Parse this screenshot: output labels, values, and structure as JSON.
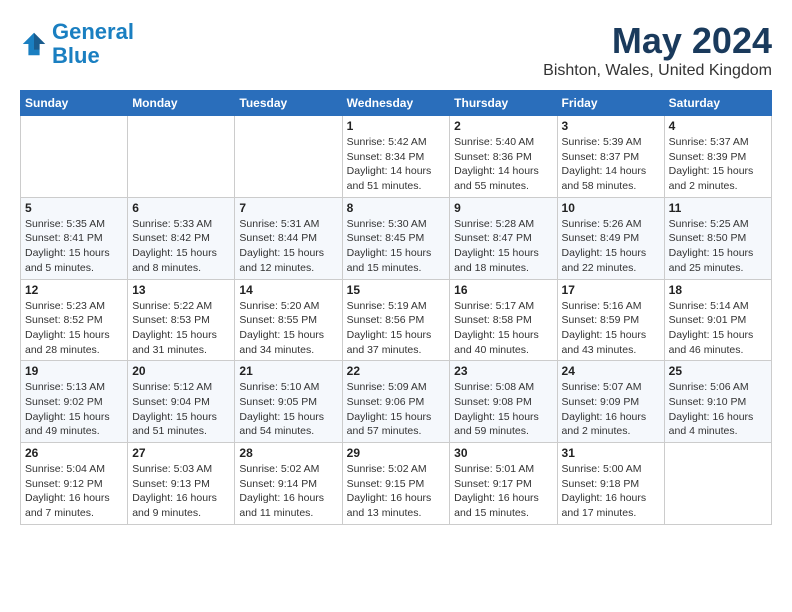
{
  "logo": {
    "line1": "General",
    "line2": "Blue"
  },
  "title": "May 2024",
  "subtitle": "Bishton, Wales, United Kingdom",
  "days_of_week": [
    "Sunday",
    "Monday",
    "Tuesday",
    "Wednesday",
    "Thursday",
    "Friday",
    "Saturday"
  ],
  "weeks": [
    [
      {
        "day": "",
        "info": ""
      },
      {
        "day": "",
        "info": ""
      },
      {
        "day": "",
        "info": ""
      },
      {
        "day": "1",
        "info": "Sunrise: 5:42 AM\nSunset: 8:34 PM\nDaylight: 14 hours\nand 51 minutes."
      },
      {
        "day": "2",
        "info": "Sunrise: 5:40 AM\nSunset: 8:36 PM\nDaylight: 14 hours\nand 55 minutes."
      },
      {
        "day": "3",
        "info": "Sunrise: 5:39 AM\nSunset: 8:37 PM\nDaylight: 14 hours\nand 58 minutes."
      },
      {
        "day": "4",
        "info": "Sunrise: 5:37 AM\nSunset: 8:39 PM\nDaylight: 15 hours\nand 2 minutes."
      }
    ],
    [
      {
        "day": "5",
        "info": "Sunrise: 5:35 AM\nSunset: 8:41 PM\nDaylight: 15 hours\nand 5 minutes."
      },
      {
        "day": "6",
        "info": "Sunrise: 5:33 AM\nSunset: 8:42 PM\nDaylight: 15 hours\nand 8 minutes."
      },
      {
        "day": "7",
        "info": "Sunrise: 5:31 AM\nSunset: 8:44 PM\nDaylight: 15 hours\nand 12 minutes."
      },
      {
        "day": "8",
        "info": "Sunrise: 5:30 AM\nSunset: 8:45 PM\nDaylight: 15 hours\nand 15 minutes."
      },
      {
        "day": "9",
        "info": "Sunrise: 5:28 AM\nSunset: 8:47 PM\nDaylight: 15 hours\nand 18 minutes."
      },
      {
        "day": "10",
        "info": "Sunrise: 5:26 AM\nSunset: 8:49 PM\nDaylight: 15 hours\nand 22 minutes."
      },
      {
        "day": "11",
        "info": "Sunrise: 5:25 AM\nSunset: 8:50 PM\nDaylight: 15 hours\nand 25 minutes."
      }
    ],
    [
      {
        "day": "12",
        "info": "Sunrise: 5:23 AM\nSunset: 8:52 PM\nDaylight: 15 hours\nand 28 minutes."
      },
      {
        "day": "13",
        "info": "Sunrise: 5:22 AM\nSunset: 8:53 PM\nDaylight: 15 hours\nand 31 minutes."
      },
      {
        "day": "14",
        "info": "Sunrise: 5:20 AM\nSunset: 8:55 PM\nDaylight: 15 hours\nand 34 minutes."
      },
      {
        "day": "15",
        "info": "Sunrise: 5:19 AM\nSunset: 8:56 PM\nDaylight: 15 hours\nand 37 minutes."
      },
      {
        "day": "16",
        "info": "Sunrise: 5:17 AM\nSunset: 8:58 PM\nDaylight: 15 hours\nand 40 minutes."
      },
      {
        "day": "17",
        "info": "Sunrise: 5:16 AM\nSunset: 8:59 PM\nDaylight: 15 hours\nand 43 minutes."
      },
      {
        "day": "18",
        "info": "Sunrise: 5:14 AM\nSunset: 9:01 PM\nDaylight: 15 hours\nand 46 minutes."
      }
    ],
    [
      {
        "day": "19",
        "info": "Sunrise: 5:13 AM\nSunset: 9:02 PM\nDaylight: 15 hours\nand 49 minutes."
      },
      {
        "day": "20",
        "info": "Sunrise: 5:12 AM\nSunset: 9:04 PM\nDaylight: 15 hours\nand 51 minutes."
      },
      {
        "day": "21",
        "info": "Sunrise: 5:10 AM\nSunset: 9:05 PM\nDaylight: 15 hours\nand 54 minutes."
      },
      {
        "day": "22",
        "info": "Sunrise: 5:09 AM\nSunset: 9:06 PM\nDaylight: 15 hours\nand 57 minutes."
      },
      {
        "day": "23",
        "info": "Sunrise: 5:08 AM\nSunset: 9:08 PM\nDaylight: 15 hours\nand 59 minutes."
      },
      {
        "day": "24",
        "info": "Sunrise: 5:07 AM\nSunset: 9:09 PM\nDaylight: 16 hours\nand 2 minutes."
      },
      {
        "day": "25",
        "info": "Sunrise: 5:06 AM\nSunset: 9:10 PM\nDaylight: 16 hours\nand 4 minutes."
      }
    ],
    [
      {
        "day": "26",
        "info": "Sunrise: 5:04 AM\nSunset: 9:12 PM\nDaylight: 16 hours\nand 7 minutes."
      },
      {
        "day": "27",
        "info": "Sunrise: 5:03 AM\nSunset: 9:13 PM\nDaylight: 16 hours\nand 9 minutes."
      },
      {
        "day": "28",
        "info": "Sunrise: 5:02 AM\nSunset: 9:14 PM\nDaylight: 16 hours\nand 11 minutes."
      },
      {
        "day": "29",
        "info": "Sunrise: 5:02 AM\nSunset: 9:15 PM\nDaylight: 16 hours\nand 13 minutes."
      },
      {
        "day": "30",
        "info": "Sunrise: 5:01 AM\nSunset: 9:17 PM\nDaylight: 16 hours\nand 15 minutes."
      },
      {
        "day": "31",
        "info": "Sunrise: 5:00 AM\nSunset: 9:18 PM\nDaylight: 16 hours\nand 17 minutes."
      },
      {
        "day": "",
        "info": ""
      }
    ]
  ]
}
